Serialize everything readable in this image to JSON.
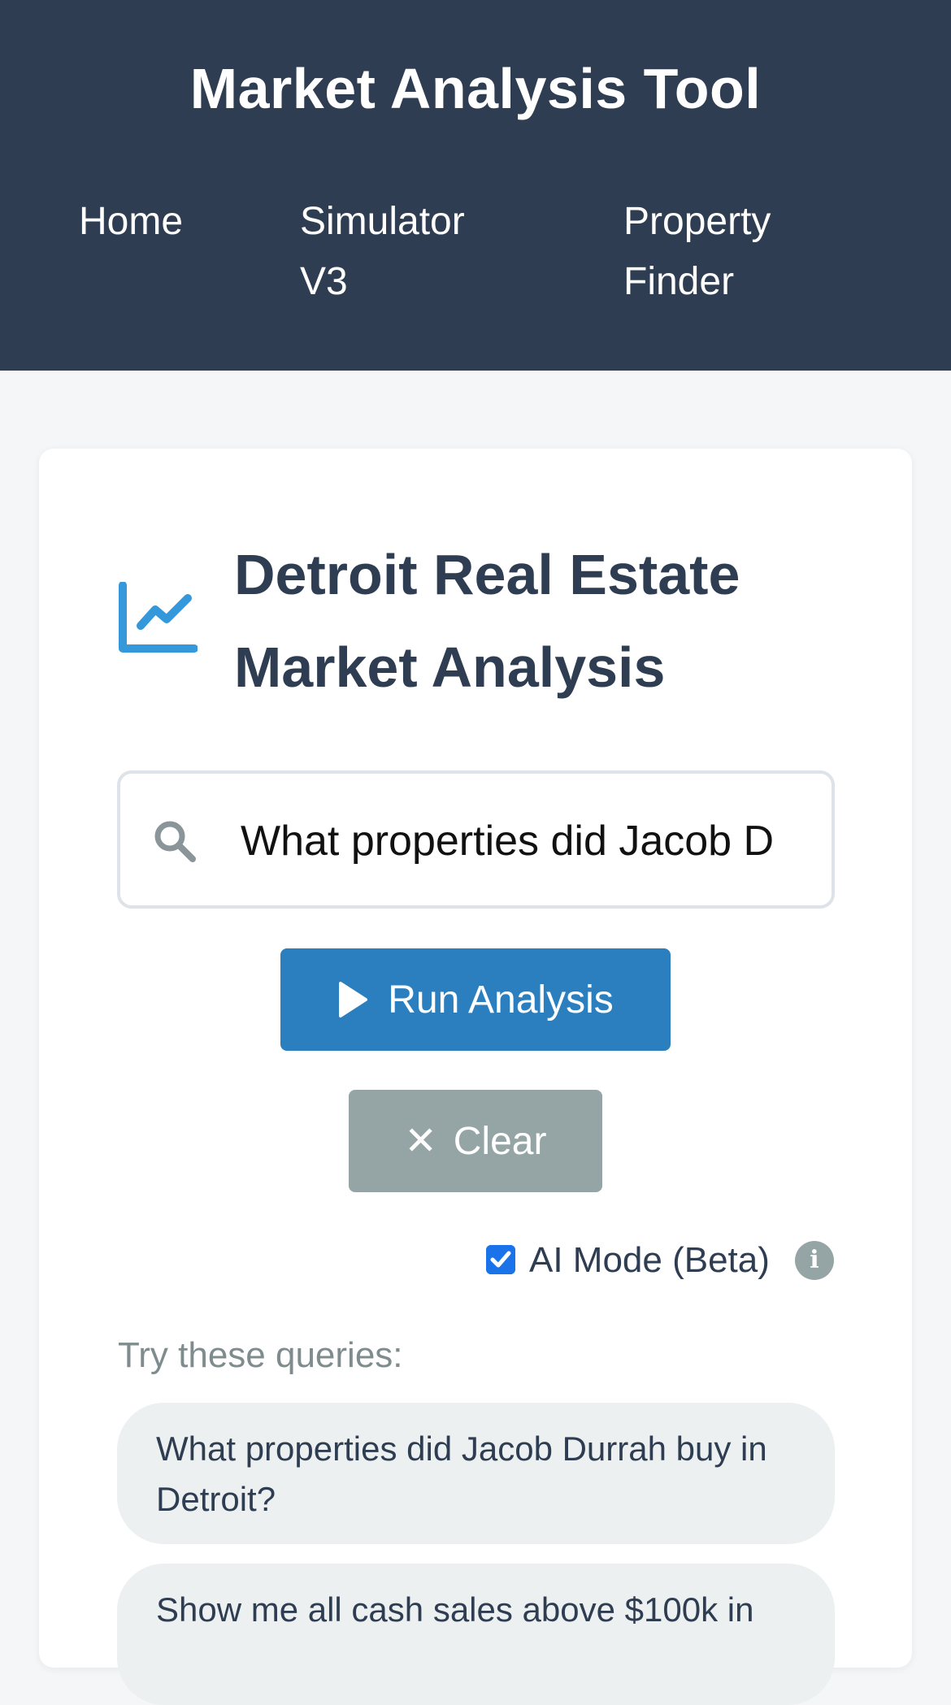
{
  "header": {
    "title": "Market Analysis Tool",
    "nav": [
      {
        "label": "Home"
      },
      {
        "label": "Simulator V3"
      },
      {
        "label": "Property Finder"
      }
    ]
  },
  "main": {
    "heading": "Detroit Real Estate Market Analysis",
    "heading_icon": "chart-line-icon",
    "search": {
      "value": "What properties did Jacob D",
      "icon": "search-icon"
    },
    "run_button": {
      "label": "Run Analysis",
      "icon": "play-icon"
    },
    "clear_button": {
      "label": "Clear",
      "icon": "close-icon"
    },
    "ai_mode": {
      "label": "AI Mode (Beta)",
      "checked": true,
      "info_icon": "info-icon"
    },
    "suggestions": {
      "label": "Try these queries:",
      "items": [
        {
          "text": "What properties did Jacob Durrah buy in Detroit?"
        },
        {
          "text": "Show me all cash sales above $100k in"
        }
      ]
    }
  },
  "colors": {
    "header_bg": "#2e3d51",
    "accent": "#2c7fbf",
    "chart_icon": "#3498db",
    "clear_button": "#95a5a6",
    "pill_bg": "#ecf0f1",
    "page_bg": "#f4f6f8"
  }
}
